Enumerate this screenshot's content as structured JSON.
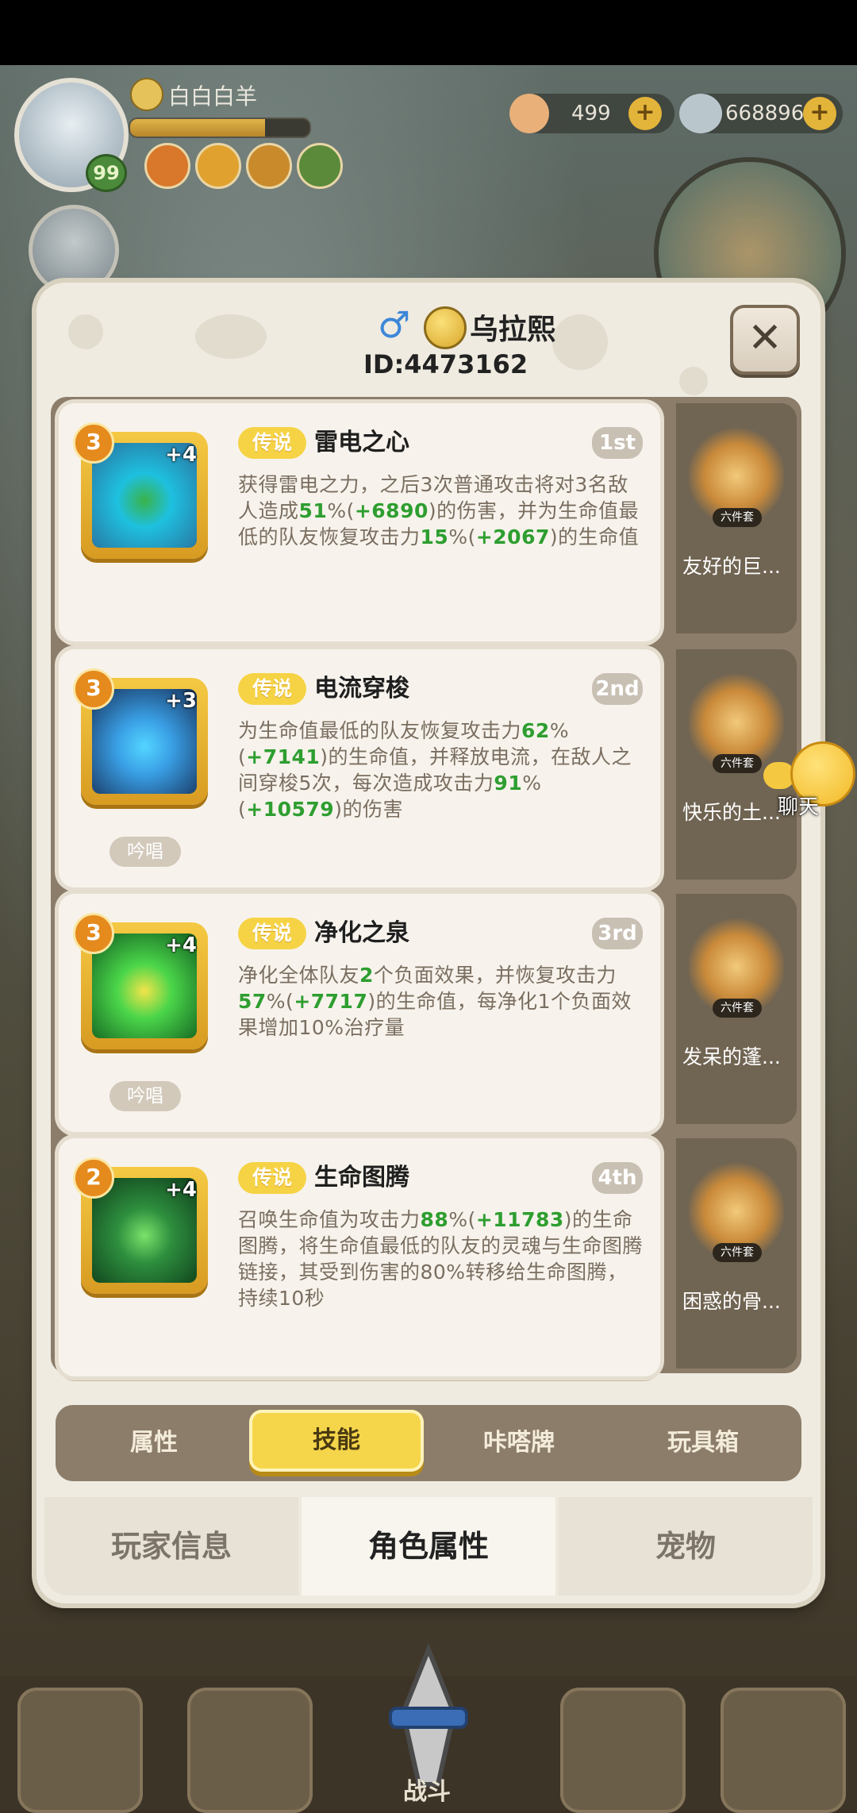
{
  "hud": {
    "player_name": "白白白羊",
    "level": "99",
    "xp_progress": 0.75,
    "currency_a": "499",
    "currency_b": "668896",
    "chat_label": "聊天"
  },
  "panel": {
    "title": "乌拉熙",
    "player_id": "ID:4473162",
    "gender_icon": "male-symbol",
    "close_icon": "close-x"
  },
  "skills": [
    {
      "rarity": "传说",
      "name": "雷电之心",
      "rank": "1st",
      "stars": "3",
      "plus": "+4",
      "chant": "",
      "desc_parts": [
        {
          "t": "获得雷电之力，之后3次普通攻击将对3名敌人造成"
        },
        {
          "t": "51",
          "g": true
        },
        {
          "t": "%("
        },
        {
          "t": "+6890",
          "g": true
        },
        {
          "t": ")的伤害，并为生命值最低的队友恢复攻击力"
        },
        {
          "t": "15",
          "g": true
        },
        {
          "t": "%("
        },
        {
          "t": "+2067",
          "g": true
        },
        {
          "t": ")的生命值"
        }
      ],
      "pet_name": "友好的巨...",
      "pet_tag": "六件套",
      "icon_colors": [
        "#1ec0e0",
        "#2b6d9a",
        "#39b34a"
      ]
    },
    {
      "rarity": "传说",
      "name": "电流穿梭",
      "rank": "2nd",
      "stars": "3",
      "plus": "+3",
      "chant": "吟唱",
      "desc_parts": [
        {
          "t": "为生命值最低的队友恢复攻击力"
        },
        {
          "t": "62",
          "g": true
        },
        {
          "t": "%("
        },
        {
          "t": "+7141",
          "g": true
        },
        {
          "t": ")的生命值，并释放电流，在敌人之间穿梭5次，每次造成攻击力"
        },
        {
          "t": "91",
          "g": true
        },
        {
          "t": "%("
        },
        {
          "t": "+10579",
          "g": true
        },
        {
          "t": ")的伤害"
        }
      ],
      "pet_name": "快乐的土...",
      "pet_tag": "六件套",
      "icon_colors": [
        "#3aa0e6",
        "#16315a",
        "#53d5ff"
      ]
    },
    {
      "rarity": "传说",
      "name": "净化之泉",
      "rank": "3rd",
      "stars": "3",
      "plus": "+4",
      "chant": "吟唱",
      "desc_parts": [
        {
          "t": "净化全体队友"
        },
        {
          "t": "2",
          "g": true
        },
        {
          "t": "个负面效果，并恢复攻击力"
        },
        {
          "t": "57",
          "g": true
        },
        {
          "t": "%("
        },
        {
          "t": "+7717",
          "g": true
        },
        {
          "t": ")的生命值，每净化1个负面效果增加10%治疗量"
        }
      ],
      "pet_name": "发呆的蓬...",
      "pet_tag": "六件套",
      "icon_colors": [
        "#4bd64a",
        "#0f5a1e",
        "#f2e44a"
      ]
    },
    {
      "rarity": "传说",
      "name": "生命图腾",
      "rank": "4th",
      "stars": "2",
      "plus": "+4",
      "chant": "",
      "desc_parts": [
        {
          "t": "召唤生命值为攻击力"
        },
        {
          "t": "88",
          "g": true
        },
        {
          "t": "%("
        },
        {
          "t": "+11783",
          "g": true
        },
        {
          "t": ")的生命图腾，将生命值最低的队友的灵魂与生命图腾链接，其受到伤害的80%转移给生命图腾，持续10秒"
        }
      ],
      "pet_name": "困惑的骨...",
      "pet_tag": "六件套",
      "icon_colors": [
        "#2e8f3e",
        "#0d3b1a",
        "#7ae26a"
      ]
    }
  ],
  "subtabs": [
    "属性",
    "技能",
    "咔嗒牌",
    "玩具箱"
  ],
  "subtab_active": 1,
  "bottomtabs": [
    "玩家信息",
    "角色属性",
    "宠物"
  ],
  "bottomtab_active": 1,
  "nav": {
    "battle_label": "战斗"
  }
}
